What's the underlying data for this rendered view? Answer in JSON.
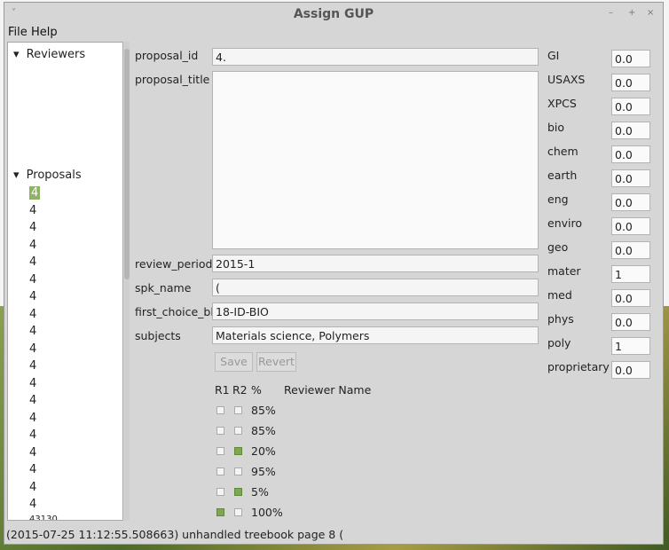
{
  "window": {
    "title": "Assign GUP",
    "controls": [
      "˅",
      "–",
      "+",
      "×"
    ]
  },
  "menu": {
    "file": "File",
    "help": "Help"
  },
  "tree": {
    "reviewers_label": "Reviewers",
    "proposals_label": "Proposals",
    "proposals": [
      "4",
      "4",
      "4",
      "4",
      "4",
      "4",
      "4",
      "4",
      "4",
      "4",
      "4",
      "4",
      "4",
      "4",
      "4",
      "4",
      "4",
      "4",
      "4"
    ],
    "partial_last": "43130"
  },
  "form": {
    "proposal_id_label": "proposal_id",
    "proposal_id_value": "4.",
    "proposal_title_label": "proposal_title",
    "review_period_label": "review_period",
    "review_period_value": "2015-1",
    "spk_name_label": "spk_name",
    "spk_name_value": "(",
    "first_choice_label": "first_choice_bl",
    "first_choice_value": "18-ID-BIO",
    "subjects_label": "subjects",
    "subjects_value": "Materials science, Polymers",
    "save": "Save",
    "revert": "Revert"
  },
  "reviewers_table": {
    "headers": {
      "r1": "R1",
      "r2": "R2",
      "pct": "%",
      "name": "Reviewer Name"
    },
    "rows": [
      {
        "r1": false,
        "r2": false,
        "pct": "85%"
      },
      {
        "r1": false,
        "r2": false,
        "pct": "85%"
      },
      {
        "r1": false,
        "r2": true,
        "pct": "20%"
      },
      {
        "r1": false,
        "r2": false,
        "pct": "95%"
      },
      {
        "r1": false,
        "r2": true,
        "pct": "5%"
      },
      {
        "r1": true,
        "r2": false,
        "pct": "100%"
      }
    ]
  },
  "subjects": [
    {
      "name": "GI",
      "value": "0.0"
    },
    {
      "name": "USAXS",
      "value": "0.0"
    },
    {
      "name": "XPCS",
      "value": "0.0"
    },
    {
      "name": "bio",
      "value": "0.0"
    },
    {
      "name": "chem",
      "value": "0.0"
    },
    {
      "name": "earth",
      "value": "0.0"
    },
    {
      "name": "eng",
      "value": "0.0"
    },
    {
      "name": "enviro",
      "value": "0.0"
    },
    {
      "name": "geo",
      "value": "0.0"
    },
    {
      "name": "mater",
      "value": "1"
    },
    {
      "name": "med",
      "value": "0.0"
    },
    {
      "name": "phys",
      "value": "0.0"
    },
    {
      "name": "poly",
      "value": "1"
    },
    {
      "name": "proprietary",
      "value": "0.0"
    }
  ],
  "status_text": "(2015-07-25 11:12:55.508663) unhandled treebook page 8 ("
}
